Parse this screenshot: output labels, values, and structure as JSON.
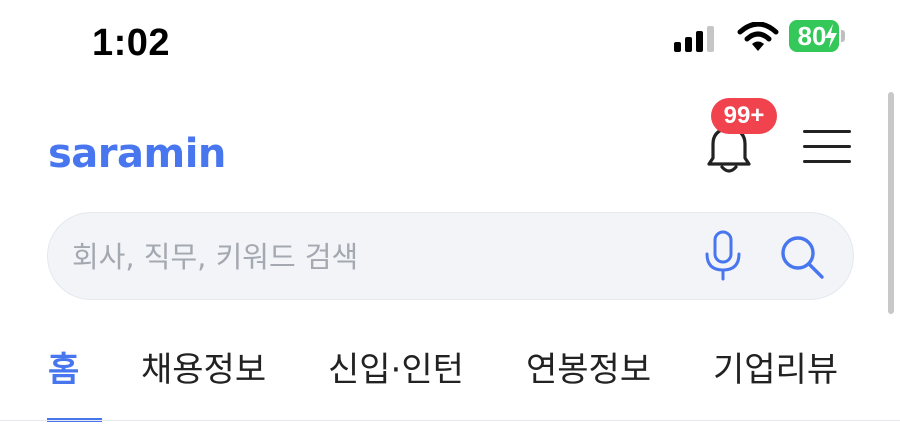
{
  "status_bar": {
    "time": "1:02",
    "battery": "80"
  },
  "header": {
    "logo": "saramin",
    "notification_badge": "99+"
  },
  "search": {
    "placeholder": "회사, 직무, 키워드 검색"
  },
  "tabs": [
    {
      "label": "홈",
      "active": true
    },
    {
      "label": "채용정보"
    },
    {
      "label": "신입·인턴"
    },
    {
      "label": "연봉정보"
    },
    {
      "label": "기업리뷰"
    }
  ],
  "colors": {
    "brand": "#4876ef",
    "badge": "#f0434e",
    "battery": "#34c759"
  },
  "icons": [
    "signal-icon",
    "wifi-icon",
    "battery-icon",
    "bell-icon",
    "menu-icon",
    "mic-icon",
    "search-icon"
  ]
}
